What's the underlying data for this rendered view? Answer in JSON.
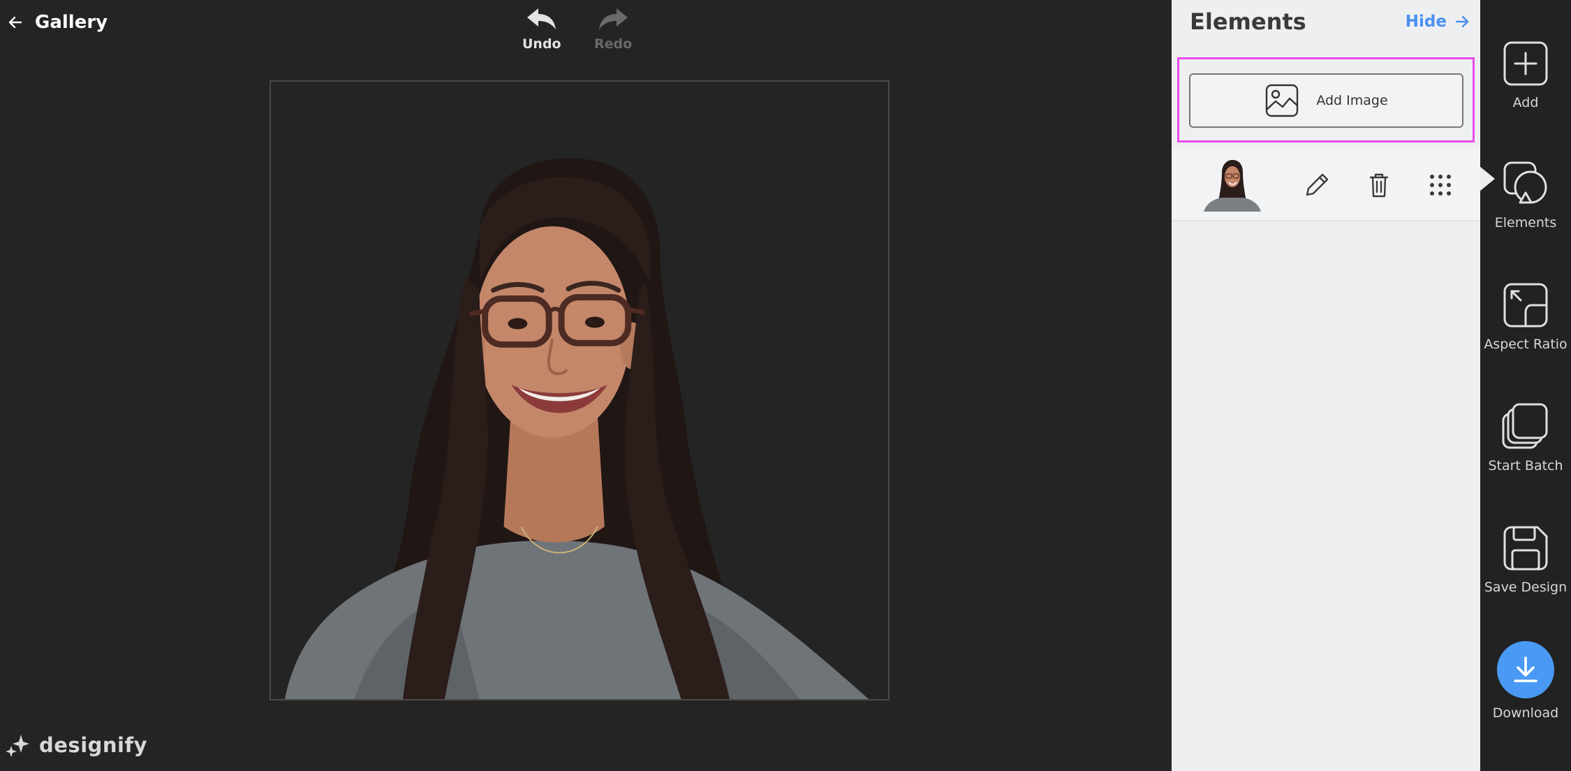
{
  "header": {
    "back_label": "Gallery",
    "undo_label": "Undo",
    "redo_label": "Redo"
  },
  "brand": {
    "logo_text": "designify"
  },
  "panel": {
    "title": "Elements",
    "hide_label": "Hide",
    "add_image_label": "Add Image",
    "elements": [
      {
        "type": "image",
        "icons": [
          "pencil-icon",
          "trash-icon",
          "drag-handle-icon"
        ]
      }
    ]
  },
  "toolbar": {
    "items": [
      {
        "label": "Add",
        "icon": "plus-square-icon"
      },
      {
        "label": "Elements",
        "icon": "shapes-icon",
        "active": true
      },
      {
        "label": "Aspect Ratio",
        "icon": "aspect-ratio-icon"
      },
      {
        "label": "Start Batch",
        "icon": "stack-icon"
      },
      {
        "label": "Save Design",
        "icon": "floppy-icon"
      },
      {
        "label": "Download",
        "icon": "download-icon"
      }
    ]
  },
  "colors": {
    "background": "#242424",
    "panel": "#eeeff1",
    "accent": "#4a90f0",
    "highlight": "#e84df0",
    "download": "#4a9af5"
  }
}
